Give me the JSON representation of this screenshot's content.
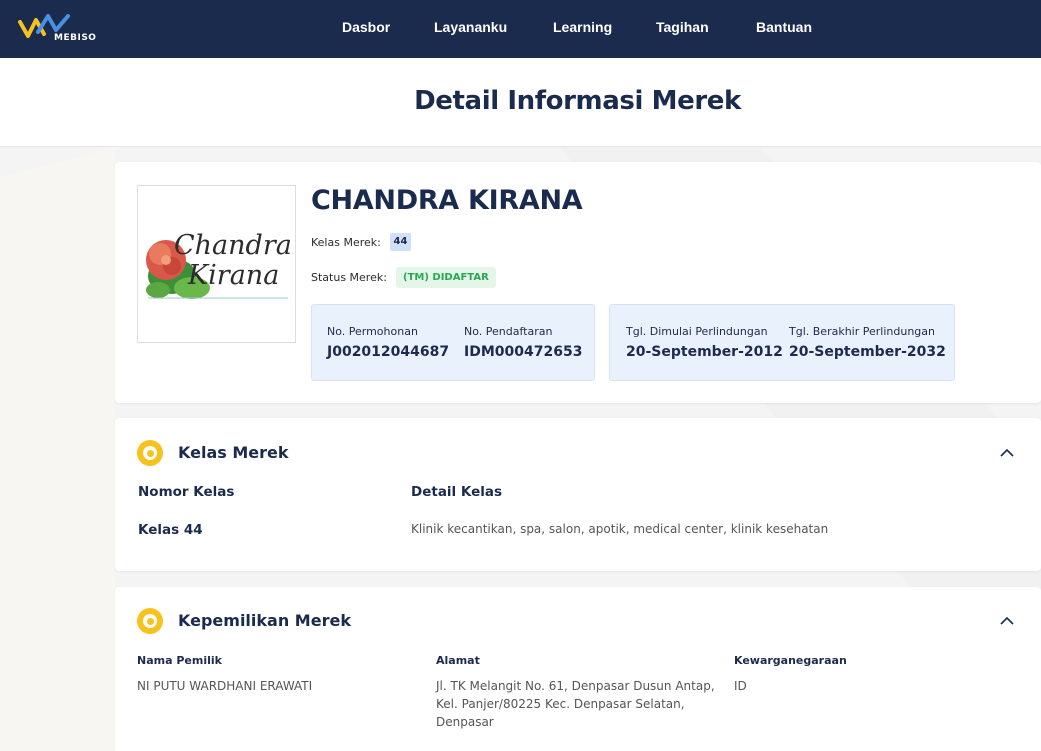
{
  "header": {
    "logo_text": "MEBISO",
    "nav": [
      {
        "label": "Dasbor"
      },
      {
        "label": "Layananku"
      },
      {
        "label": "Learning"
      },
      {
        "label": "Tagihan"
      },
      {
        "label": "Bantuan"
      }
    ]
  },
  "page_title": "Detail Informasi Merek",
  "brand": {
    "name": "CHANDRA KIRANA",
    "logo_text_line1": "Chandra",
    "logo_text_line2": "Kirana",
    "class_label": "Kelas Merek:",
    "class_value": "44",
    "status_label": "Status Merek:",
    "status_value": "(TM) DIDAFTAR",
    "application_no_label": "No. Permohonan",
    "application_no": "J002012044687",
    "registration_no_label": "No. Pendaftaran",
    "registration_no": "IDM000472653",
    "protection_start_label": "Tgl. Dimulai Perlindungan",
    "protection_start": "20-September-2012",
    "protection_end_label": "Tgl. Berakhir Perlindungan",
    "protection_end": "20-September-2032"
  },
  "class_section": {
    "title": "Kelas Merek",
    "col_number": "Nomor Kelas",
    "col_detail": "Detail Kelas",
    "rows": [
      {
        "number": "Kelas 44",
        "detail": "Klinik kecantikan, spa, salon, apotik, medical center, klinik kesehatan"
      }
    ]
  },
  "ownership_section": {
    "title": "Kepemilikan Merek",
    "owner_label": "Nama Pemilik",
    "owner_value": "NI PUTU WARDHANI ERAWATI",
    "address_label": "Alamat",
    "address_line1": "Jl. TK Melangit No. 61, Denpasar Dusun Antap,",
    "address_line2": "Kel. Panjer/80225 Kec. Denpasar Selatan,",
    "address_line3": "Denpasar",
    "citizenship_label": "Kewarganegaraan",
    "citizenship_value": "ID"
  },
  "colors": {
    "header_bg": "#1a2b4e",
    "accent_yellow": "#f7c21d",
    "status_green": "#2aa651",
    "info_box_bg": "#e9f1fd"
  }
}
